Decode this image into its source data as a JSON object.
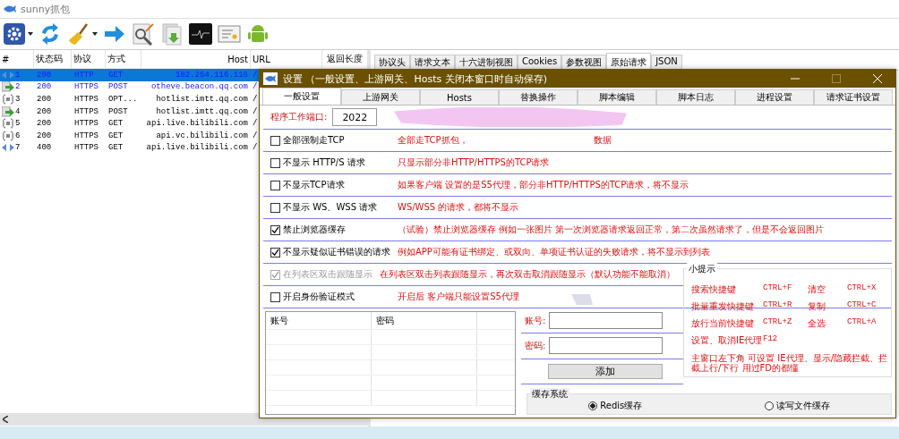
{
  "window": {
    "title": "sunny抓包"
  },
  "list": {
    "columns": [
      "#",
      "状态码",
      "协议",
      "方式",
      "Host",
      "URL",
      "返回长度"
    ],
    "rows": [
      {
        "kind": "socket",
        "num": "1",
        "status": "200",
        "protocol": "HTTP",
        "method": "GET",
        "host": "182.254.116.116",
        "url": "/",
        "selected": true,
        "highlighted": true
      },
      {
        "kind": "post",
        "num": "2",
        "status": "200",
        "protocol": "HTTPS",
        "method": "POST",
        "host": "otheve.beacon.qq.com",
        "url": "/",
        "selected": false,
        "highlighted": true
      },
      {
        "kind": "json",
        "num": "3",
        "status": "200",
        "protocol": "HTTPS",
        "method": "OPT...",
        "host": "hotlist.imtt.qq.com",
        "url": "/",
        "selected": false,
        "highlighted": false
      },
      {
        "kind": "post",
        "num": "4",
        "status": "200",
        "protocol": "HTTPS",
        "method": "POST",
        "host": "hotlist.imtt.qq.com",
        "url": "/",
        "selected": false,
        "highlighted": false
      },
      {
        "kind": "json",
        "num": "5",
        "status": "200",
        "protocol": "HTTPS",
        "method": "GET",
        "host": "api.live.bilibili.com",
        "url": "/",
        "selected": false,
        "highlighted": false
      },
      {
        "kind": "json",
        "num": "6",
        "status": "200",
        "protocol": "HTTPS",
        "method": "GET",
        "host": "api.vc.bilibili.com",
        "url": "/",
        "selected": false,
        "highlighted": false
      },
      {
        "kind": "socket",
        "num": "7",
        "status": "400",
        "protocol": "HTTPS",
        "method": "GET",
        "host": "api.live.bilibili.com",
        "url": "/",
        "selected": false,
        "highlighted": false
      }
    ]
  },
  "detail_tabs": [
    {
      "label": "协议头",
      "selected": false
    },
    {
      "label": "请求文本",
      "selected": false
    },
    {
      "label": "十六进制视图",
      "selected": false
    },
    {
      "label": "Cookies",
      "selected": false
    },
    {
      "label": "参数视图",
      "selected": false
    },
    {
      "label": "原始请求",
      "selected": true
    },
    {
      "label": "JSON",
      "selected": false
    }
  ],
  "dialog": {
    "title": "设置 （一般设置、上游网关、Hosts 关闭本窗口时自动保存)",
    "tabs": [
      {
        "label": "一般设置",
        "selected": true
      },
      {
        "label": "上游网关",
        "selected": false
      },
      {
        "label": "Hosts",
        "selected": false
      },
      {
        "label": "替换操作",
        "selected": false
      },
      {
        "label": "脚本编辑",
        "selected": false
      },
      {
        "label": "脚本日志",
        "selected": false
      },
      {
        "label": "进程设置",
        "selected": false
      },
      {
        "label": "请求证书设置",
        "selected": false
      }
    ],
    "port": {
      "label": "程序工作端口:",
      "value": "2022"
    },
    "options": [
      {
        "label": "全部强制走TCP",
        "checked": false,
        "disabled": false,
        "description": "全部走TCP抓包，",
        "description_end": "数据"
      },
      {
        "label": "不显示 HTTP/S 请求",
        "checked": false,
        "disabled": false,
        "description": "只显示部分非HTTP/HTTPS的TCP请求"
      },
      {
        "label": "不显示TCP请求",
        "checked": false,
        "disabled": false,
        "description": "如果客户端 设置的是S5代理，部分非HTTP/HTTPS的TCP请求，将不显示"
      },
      {
        "label": "不显示 WS、WSS 请求",
        "checked": false,
        "disabled": false,
        "description": "WS/WSS 的请求，都将不显示"
      },
      {
        "label": "禁止浏览器缓存",
        "checked": true,
        "disabled": false,
        "description": "（试验）禁止浏览器缓存 例如一张图片 第一次浏览器请求返回正常，第二次虽然请求了，但是不会返回图片"
      },
      {
        "label": "不显示疑似证书错误的请求",
        "checked": true,
        "disabled": false,
        "description": "例如APP可能有证书绑定、或双向、单项证书认证的失败请求，将不显示到列表"
      },
      {
        "label": "在列表区双击跟随显示",
        "checked": true,
        "disabled": true,
        "description": "在列表区双击列表跟随显示，再次双击取消跟随显示（默认功能不能取消）"
      },
      {
        "label": "开启身份验证模式",
        "checked": false,
        "disabled": false,
        "description": "开启后 客户端只能设置S5代理"
      }
    ],
    "accounts_table": {
      "columns": [
        "账号",
        "密码"
      ]
    },
    "account_form": {
      "account_label": "账号:",
      "password_label": "密码:",
      "add_button": "添加"
    },
    "tips": {
      "title": "小提示",
      "rows": [
        [
          "搜索快捷键",
          "CTRL+F",
          "清空",
          "CTRL+X"
        ],
        [
          "批量重发快捷键",
          "CTRL+R",
          "复制",
          "CTRL+C"
        ],
        [
          "放行当前快捷键",
          "CTRL+Z",
          "全选",
          "CTRL+A"
        ],
        [
          "设置、取消IE代理",
          "F12"
        ]
      ],
      "note": "主窗口左下角 可设置 IE代理、显示/隐藏拦截、拦截上行/下行 用过FD的都懂"
    },
    "cache": {
      "title": "缓存系统",
      "options": [
        {
          "label": "Redis缓存",
          "selected": true
        },
        {
          "label": "读写文件缓存",
          "selected": false
        }
      ]
    }
  }
}
